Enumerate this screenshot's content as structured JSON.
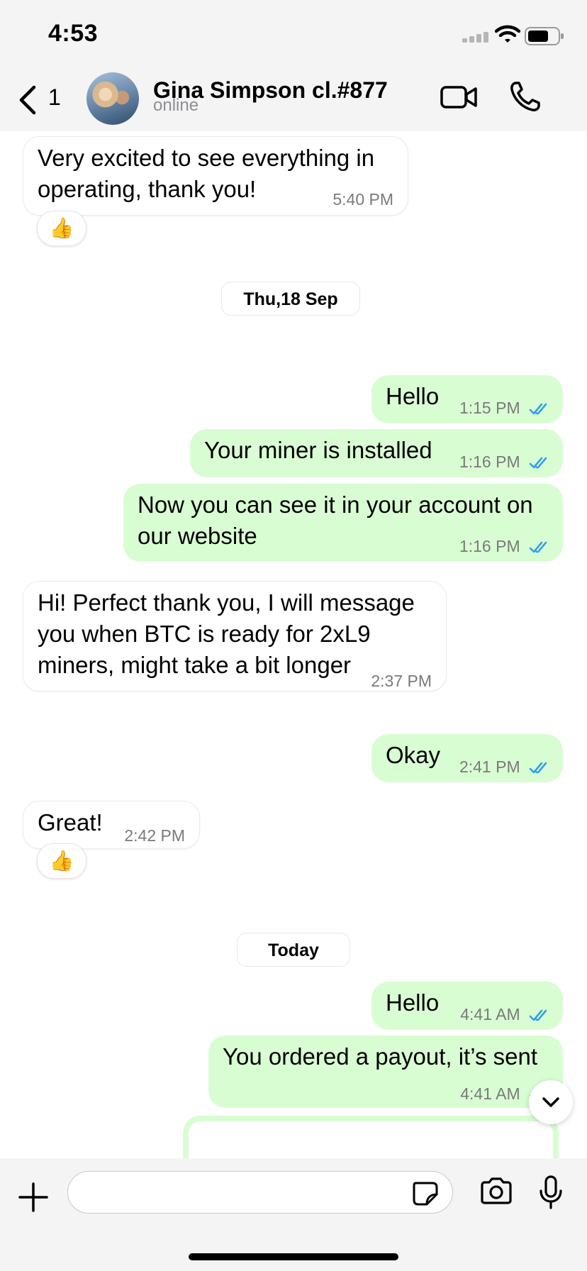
{
  "status_bar": {
    "time": "4:53"
  },
  "header": {
    "back_count": "1",
    "contact_name": "Gina Simpson cl.#877",
    "contact_status": "online"
  },
  "messages": [
    {
      "dir": "in",
      "text_lines": [
        "Very excited to see everything in",
        "operating, thank you!"
      ],
      "time": "5:40 PM",
      "reaction": "👍"
    },
    {
      "date_divider": "Thu,18 Sep"
    },
    {
      "dir": "out",
      "text_lines": [
        "Hello"
      ],
      "time": "1:15 PM",
      "read": true
    },
    {
      "dir": "out",
      "text_lines": [
        "Your miner is installed"
      ],
      "time": "1:16 PM",
      "read": true
    },
    {
      "dir": "out",
      "text_lines": [
        "Now you can see it in your account on",
        "our website"
      ],
      "time": "1:16 PM",
      "read": true
    },
    {
      "dir": "in",
      "text_lines": [
        "Hi! Perfect thank you, I will message",
        "you when BTC is ready for 2xL9",
        "miners, might take a bit longer"
      ],
      "time": "2:37 PM"
    },
    {
      "dir": "out",
      "text_lines": [
        "Okay"
      ],
      "time": "2:41 PM",
      "read": true
    },
    {
      "dir": "in",
      "text_lines": [
        "Great!"
      ],
      "time": "2:42 PM",
      "reaction": "👍"
    },
    {
      "date_divider": "Today"
    },
    {
      "dir": "out",
      "text_lines": [
        "Hello"
      ],
      "time": "4:41 AM",
      "read": true
    },
    {
      "dir": "out",
      "text_lines": [
        "You ordered a payout, it’s sent"
      ],
      "time": "4:41 AM",
      "read": true
    }
  ],
  "colors": {
    "outgoing_bubble": "#d9fdd3",
    "incoming_bubble": "#ffffff",
    "read_ticks": "#34a0e8",
    "bars": "#f4f4f5"
  },
  "icons": [
    "back-chevron-icon",
    "video-call-icon",
    "phone-call-icon",
    "plus-icon",
    "sticker-icon",
    "camera-icon",
    "microphone-icon",
    "chevron-down-icon",
    "wifi-icon",
    "signal-icon",
    "battery-icon"
  ]
}
